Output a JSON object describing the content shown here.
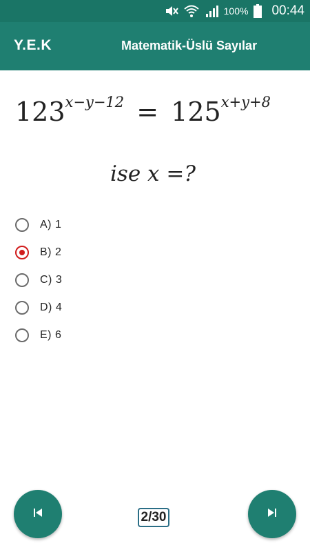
{
  "status_bar": {
    "icons": [
      "mute-icon",
      "wifi-icon",
      "signal-icon",
      "battery-icon"
    ],
    "battery": "100%",
    "time": "00:44"
  },
  "app_bar": {
    "brand": "Y.E.K",
    "title": "Matematik-Üslü Sayılar"
  },
  "question": {
    "lhs_base": "123",
    "lhs_exp": "x−y−12",
    "op": "=",
    "rhs_base": "125",
    "rhs_exp": "x+y+8",
    "prompt": "ise x =?"
  },
  "options": [
    {
      "label": "A)  1",
      "selected": false
    },
    {
      "label": "B)  2",
      "selected": true
    },
    {
      "label": "C)  3",
      "selected": false
    },
    {
      "label": "D)  4",
      "selected": false
    },
    {
      "label": "E)  6",
      "selected": false
    }
  ],
  "navigation": {
    "counter": "2/30",
    "prev_icon": "skip-previous-icon",
    "next_icon": "skip-next-icon"
  },
  "colors": {
    "status_bar": "#1a7566",
    "app_bar": "#1f7f71",
    "selected_radio": "#d11c1c"
  }
}
